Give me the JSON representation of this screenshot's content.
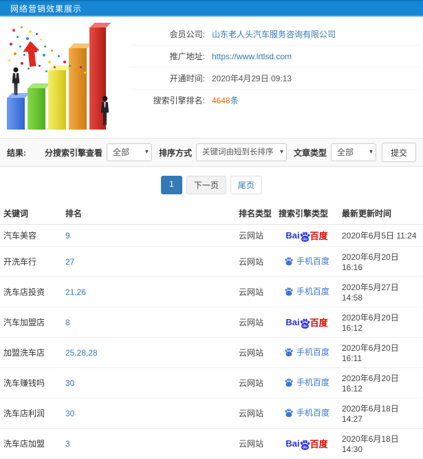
{
  "header": {
    "title": "网络营销效果展示"
  },
  "info": {
    "member_company": {
      "label": "会员公司:",
      "value": "山东老人头汽车服务咨询有限公司"
    },
    "promo_url": {
      "label": "推广地址:",
      "value": "https://www.lrtlsd.com"
    },
    "open_time": {
      "label": "开通时间:",
      "value": "2020年4月29日 09:13"
    },
    "ranking": {
      "label": "搜索引擎排名:",
      "value": "4648",
      "unit": "条"
    }
  },
  "filters": {
    "result_label": "结果:",
    "engine_label": "分搜索引擎查看",
    "engine_value": "全部",
    "sort_label": "排序方式",
    "sort_value": "关键词由短到长排序",
    "article_label": "文章类型",
    "article_value": "全部",
    "submit_label": "提交"
  },
  "pagination": {
    "current": "1",
    "next": "下一页",
    "last": "尾页"
  },
  "table": {
    "headers": [
      "关键词",
      "排名",
      "排名类型",
      "搜索引擎类型",
      "最新更新时间"
    ],
    "rows": [
      {
        "keyword": "汽车美容",
        "rank": "9",
        "rank_type": "云网站",
        "engine": "baidu",
        "updated": "2020年6月5日 11:24"
      },
      {
        "keyword": "开洗车行",
        "rank": "27",
        "rank_type": "云网站",
        "engine": "mobile_baidu",
        "updated": "2020年6月20日 16:16"
      },
      {
        "keyword": "洗车店投资",
        "rank": "21,26",
        "rank_type": "云网站",
        "engine": "mobile_baidu",
        "updated": "2020年5月27日 14:58"
      },
      {
        "keyword": "汽车加盟店",
        "rank": "8",
        "rank_type": "云网站",
        "engine": "baidu",
        "updated": "2020年6月20日 16:12"
      },
      {
        "keyword": "加盟洗车店",
        "rank": "25,28,28",
        "rank_type": "云网站",
        "engine": "mobile_baidu",
        "updated": "2020年6月20日 16:11"
      },
      {
        "keyword": "洗车赚钱吗",
        "rank": "30",
        "rank_type": "云网站",
        "engine": "mobile_baidu",
        "updated": "2020年6月20日 16:12"
      },
      {
        "keyword": "洗车店利润",
        "rank": "30",
        "rank_type": "云网站",
        "engine": "mobile_baidu",
        "updated": "2020年6月18日 14:27"
      },
      {
        "keyword": "洗车店加盟",
        "rank": "3",
        "rank_type": "云网站",
        "engine": "baidu",
        "updated": "2020年6月18日 14:30"
      }
    ]
  },
  "engines": {
    "baidu": {
      "bai": "Bai",
      "du": "du",
      "cn": "百度"
    },
    "mobile_baidu": {
      "label": "手机百度"
    }
  },
  "colors": {
    "header_blue": "#1787d3",
    "link_blue": "#337ab7",
    "highlight_orange": "#ff6600",
    "baidu_blue": "#2932e1",
    "baidu_red": "#e10601",
    "mobile_blue": "#3c76d2"
  }
}
